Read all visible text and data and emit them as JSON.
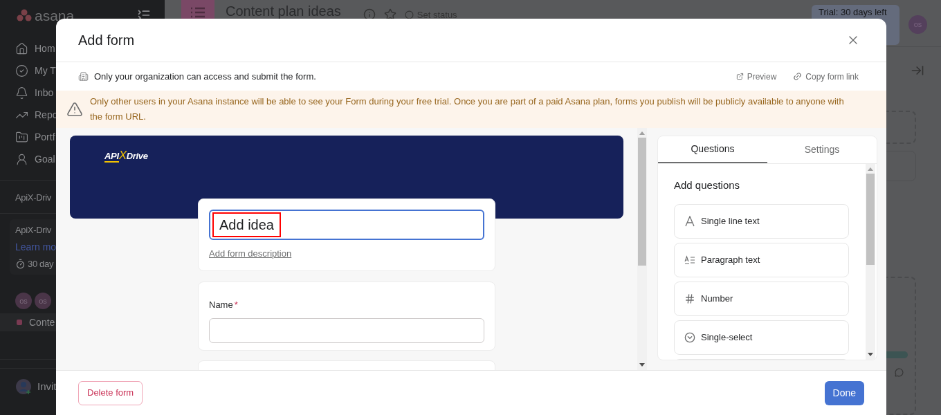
{
  "sidebar": {
    "logo": "asana",
    "nav": [
      {
        "label": "Hom"
      },
      {
        "label": "My T"
      },
      {
        "label": "Inbo"
      },
      {
        "label": "Repo"
      },
      {
        "label": "Portf"
      },
      {
        "label": "Goal"
      }
    ],
    "team_title": "ApiX-Driv",
    "trial_card": {
      "title": "ApiX-Driv",
      "link": "Learn mo",
      "days": "30 day"
    },
    "members": [
      "os",
      "os"
    ],
    "projects": [
      {
        "label": "Conte",
        "color": "#7a3a52"
      }
    ],
    "invite": "Invit"
  },
  "header": {
    "project_title": "Content plan ideas",
    "set_status": "Set status",
    "trial": "Trial: 30 days left",
    "avatar": "os"
  },
  "modal": {
    "title": "Add form",
    "access_note": "Only your organization can access and submit the form.",
    "actions": [
      {
        "label": "Preview"
      },
      {
        "label": "Copy form link"
      }
    ],
    "warning": "Only other users in your Asana instance will be able to see your Form during your free trial. Once you are part of a paid Asana plan, forms you publish will be publicly available to anyone with the form URL.",
    "banner_logo": [
      "API",
      "X",
      "Drive"
    ],
    "form": {
      "title": "Add idea",
      "annotated": true,
      "description_link": "Add form description",
      "questions": [
        {
          "label": "Name",
          "required": true,
          "required_mark": "*"
        }
      ]
    },
    "panel": {
      "tabs": [
        {
          "label": "Questions",
          "selected": true
        },
        {
          "label": "Settings",
          "selected": false
        }
      ],
      "heading": "Add questions",
      "types": [
        {
          "label": "Single line text"
        },
        {
          "label": "Paragraph text"
        },
        {
          "label": "Number"
        },
        {
          "label": "Single-select"
        }
      ]
    },
    "footer": {
      "delete": "Delete form",
      "done": "Done"
    }
  }
}
